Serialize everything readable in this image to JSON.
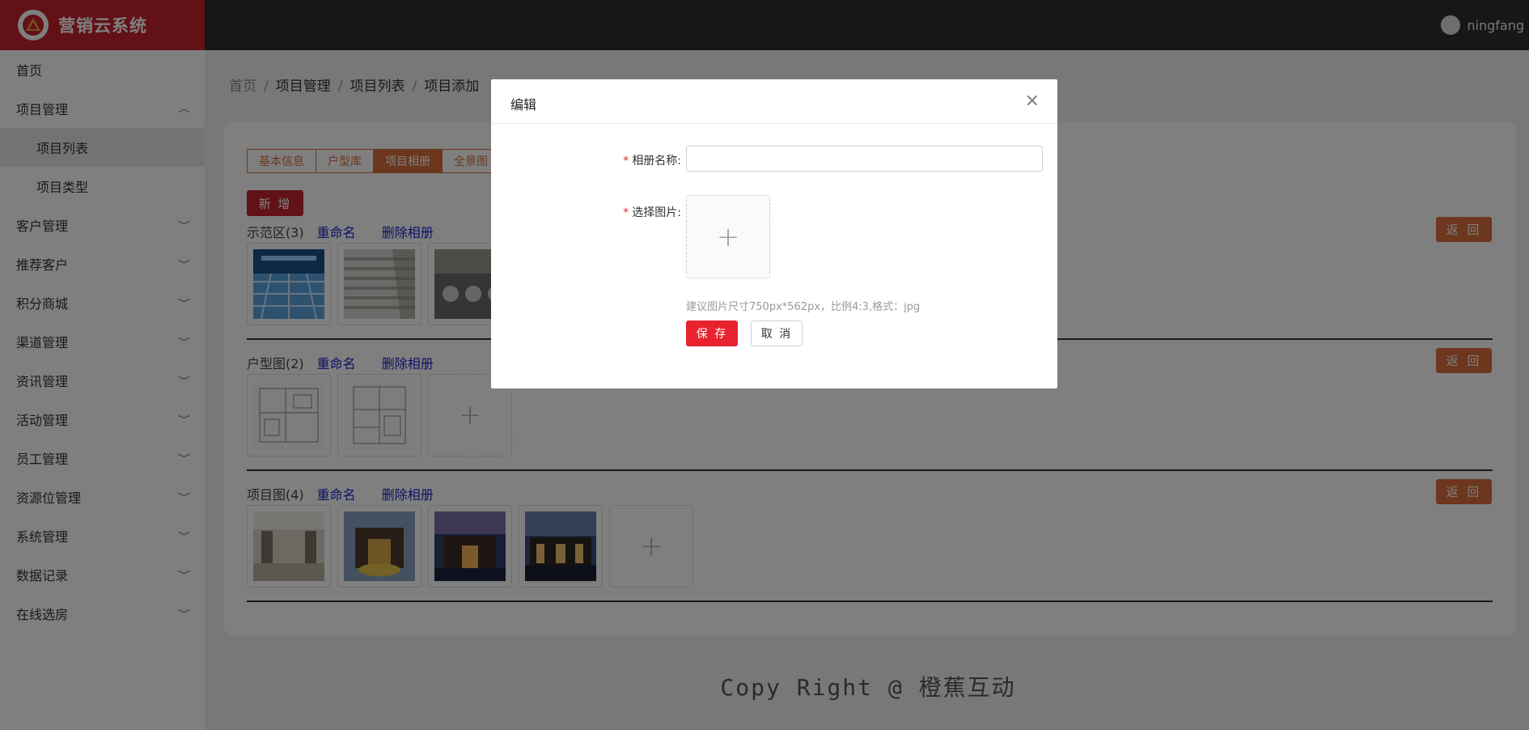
{
  "header": {
    "app_title": "营销云系统",
    "username": "ningfang"
  },
  "sidebar": {
    "items": [
      {
        "label": "首页"
      },
      {
        "label": "项目管理"
      },
      {
        "label": "项目列表"
      },
      {
        "label": "项目类型"
      },
      {
        "label": "客户管理"
      },
      {
        "label": "推荐客户"
      },
      {
        "label": "积分商城"
      },
      {
        "label": "渠道管理"
      },
      {
        "label": "资讯管理"
      },
      {
        "label": "活动管理"
      },
      {
        "label": "员工管理"
      },
      {
        "label": "资源位管理"
      },
      {
        "label": "系统管理"
      },
      {
        "label": "数据记录"
      },
      {
        "label": "在线选房"
      }
    ]
  },
  "breadcrumb": [
    "首页",
    "项目管理",
    "项目列表",
    "项目添加"
  ],
  "tabs": [
    "基本信息",
    "户型库",
    "项目相册",
    "全景图"
  ],
  "add_button": "新 增",
  "back_button": "返 回",
  "rename_link": "重命名",
  "delete_album_link": "删除相册",
  "albums": [
    {
      "title": "示范区(3)"
    },
    {
      "title": "户型图(2)"
    },
    {
      "title": "项目图(4)"
    }
  ],
  "footer": "Copy Right @ 橙蕉互动",
  "dialog": {
    "title": "编辑",
    "album_name_label": "相册名称:",
    "album_name_value": "",
    "select_image_label": "选择图片:",
    "hint": "建议图片尺寸750px*562px，比例4:3,格式：jpg",
    "save": "保 存",
    "cancel": "取 消"
  },
  "colors": {
    "brand_red": "#c4222c",
    "accent_orange": "#d86f3b",
    "link_blue": "#1a23c9"
  }
}
